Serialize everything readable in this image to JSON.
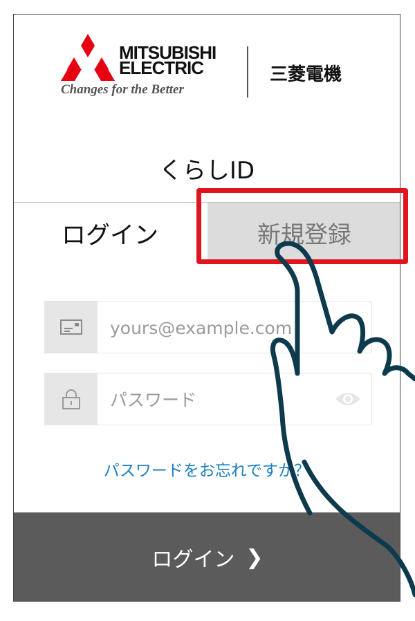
{
  "brand": {
    "name_line1": "MITSUBISHI",
    "name_line2": "ELECTRIC",
    "tagline": "Changes for the Better",
    "name_jp": "三菱電機",
    "logo_color": "#e60012"
  },
  "app": {
    "title": "くらしID"
  },
  "tabs": {
    "login": "ログイン",
    "register": "新規登録"
  },
  "form": {
    "email": {
      "icon": "envelope-card-icon",
      "placeholder": "yours@example.com",
      "value": ""
    },
    "password": {
      "icon": "lock-icon",
      "placeholder": "パスワード",
      "value": "",
      "toggle_icon": "eye-icon"
    }
  },
  "forgot_password": "パスワードをお忘れですか？",
  "login_button": {
    "label": "ログイン",
    "icon": "chevron-right-icon"
  },
  "colors": {
    "highlight": "#e0141e",
    "link": "#1a7fc1",
    "button_bg": "#5b5b5b",
    "hand_stroke": "#0d3a4c"
  }
}
